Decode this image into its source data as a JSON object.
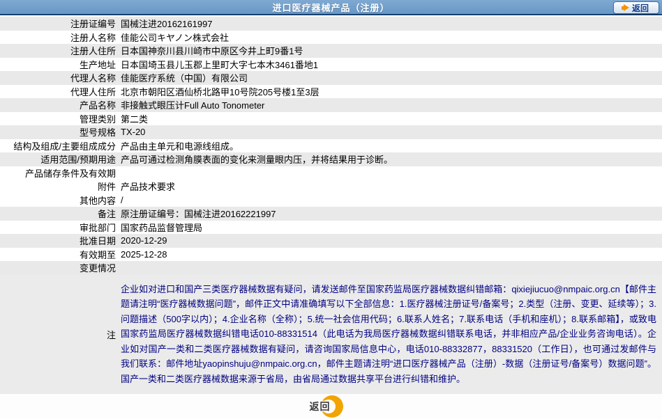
{
  "header": {
    "title": "进口医疗器械产品（注册）",
    "back_label": "返回"
  },
  "colors": {
    "header_bg": "#6897c6",
    "header_border": "#16406f",
    "shaded_row": "#e9e9e9",
    "note_text": "#000080",
    "accent_orange": "#f2a400",
    "back_button_text": "#123c8a"
  },
  "icons": {
    "top_back_arrow": "right-arrow-icon",
    "bottom_back_circle": "crescent-circle-icon"
  },
  "table": {
    "rows": [
      {
        "label": "注册证编号",
        "value": "国械注进20162161997",
        "shaded": true
      },
      {
        "label": "注册人名称",
        "value": "佳能公司キヤノン株式会社",
        "shaded": false
      },
      {
        "label": "注册人住所",
        "value": "日本国神奈川县川崎市中原区今井上町9番1号",
        "shaded": true
      },
      {
        "label": "生产地址",
        "value": "日本国埼玉县儿玉郡上里町大字七本木3461番地1",
        "shaded": false
      },
      {
        "label": "代理人名称",
        "value": "佳能医疗系统（中国）有限公司",
        "shaded": true
      },
      {
        "label": "代理人住所",
        "value": "北京市朝阳区酒仙桥北路甲10号院205号楼1至3层",
        "shaded": false
      },
      {
        "label": "产品名称",
        "value": "非接触式眼压计Full Auto Tonometer",
        "shaded": true
      },
      {
        "label": "管理类别",
        "value": "第二类",
        "shaded": false
      },
      {
        "label": "型号规格",
        "value": "TX-20",
        "shaded": true
      },
      {
        "label": "结构及组成/主要组成成分",
        "value": "产品由主单元和电源线组成。",
        "shaded": false
      },
      {
        "label": "适用范围/预期用途",
        "value": "产品可通过检测角膜表面的变化来测量眼内压，并将结果用于诊断。",
        "shaded": true
      },
      {
        "label": "产品储存条件及有效期",
        "value": "",
        "shaded": false
      },
      {
        "label": "附件",
        "value": "产品技术要求",
        "shaded": false
      },
      {
        "label": "其他内容",
        "value": "/",
        "shaded": false
      },
      {
        "label": "备注",
        "value": "原注册证编号：国械注进20162221997",
        "shaded": true
      },
      {
        "label": "审批部门",
        "value": "国家药品监督管理局",
        "shaded": false
      },
      {
        "label": "批准日期",
        "value": "2020-12-29",
        "shaded": true
      },
      {
        "label": "有效期至",
        "value": "2025-12-28",
        "shaded": false
      },
      {
        "label": "变更情况",
        "value": "",
        "shaded": true
      }
    ],
    "note": {
      "label": "注",
      "text": "企业如对进口和国产三类医疗器械数据有疑问，请发送邮件至国家药监局医疗器械数据纠错邮箱：qixiejiucuo@nmpaic.org.cn【邮件主题请注明“医疗器械数据问题”，邮件正文中请准确填写以下全部信息：1.医疗器械注册证号/备案号；2.类型（注册、变更、延续等）；3.问题描述（500字以内）；4.企业名称（全称）；5.统一社会信用代码；6.联系人姓名；7.联系电话（手机和座机）；8.联系邮箱】，或致电国家药监局医疗器械数据纠错电话010-88331514（此电话为我局医疗器械数据纠错联系电话，并非相应产品/企业业务咨询电话）。企业如对国产一类和二类医疗器械数据有疑问，请咨询国家局信息中心，电话010-88332877，88331520（工作日），也可通过发邮件与我们联系：邮件地址yaopinshuju@nmpaic.org.cn，邮件主题请注明“进口医疗器械产品（注册）-数据（注册证号/备案号）数据问题”。国产一类和二类医疗器械数据来源于省局，由省局通过数据共享平台进行纠错和维护。"
    }
  },
  "footer": {
    "back_label": "返回"
  }
}
